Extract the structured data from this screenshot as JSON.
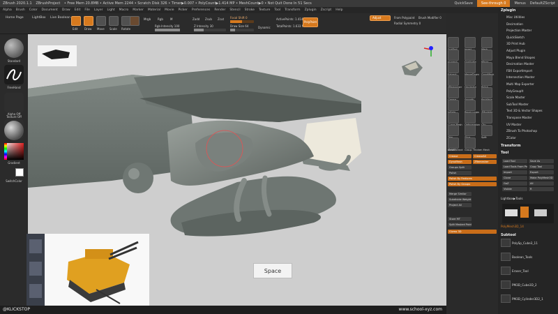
{
  "title_bar": {
    "app": "ZBrush 2020.1.1",
    "project": "ZBrushProject",
    "status": "• Free Mem 20.8MB • Active Mem 2244 • Scratch Disk 326 • Timer▶0.007 • PolyCount▶1.414 MP • MeshCount▶0 • Not Quit Done In 51 Secs",
    "quicksave": "QuickSave",
    "see_through": "See-through 0",
    "menus_label": "Menus",
    "script": "DefaultZScript"
  },
  "menu_bar": [
    "Alpha",
    "Brush",
    "Color",
    "Document",
    "Draw",
    "Edit",
    "File",
    "Layer",
    "Light",
    "Macro",
    "Marker",
    "Material",
    "Movie",
    "Picker",
    "Preferences",
    "Render",
    "Stencil",
    "Stroke",
    "Texture",
    "Tool",
    "Transform",
    "Zplugin",
    "Zscript",
    "Help"
  ],
  "right_menu": "Zplugin",
  "toolbar": {
    "home_page": "Home Page",
    "lightbox": "LightBox",
    "live_boolean": "Live Boolean",
    "edit": "Edit",
    "draw": "Draw",
    "move": "Move",
    "scale": "Scale",
    "rotate": "Rotate",
    "mrgb": "Mrgb",
    "rgb": "Rgb",
    "m": "M",
    "zadd": "Zadd",
    "zsub": "Zsub",
    "zcut": "Zcut",
    "focal_shift": "Focal Shift 0",
    "draw_size": "Draw Size 64",
    "dynamic": "Dynamic",
    "active_points": "ActivePoints: 1.414 Mil",
    "total_points": "TotalPoints: 1.633 Mil",
    "rgb_intensity": "Rgb Intensity 100",
    "z_intensity": "Z Intensity 30",
    "adjust": "Adjust",
    "polypaint": "PolyPaint",
    "from_polypaint": "From Polypaint",
    "radial_symmetry": "Radial Symmetry 0",
    "brush_modifier": "Brush Modifier 0"
  },
  "left_panel": {
    "standard": "Standard",
    "freehand": "FreeHand",
    "alpha_off": "Alpha Off",
    "texture_off": "Texture Off",
    "matcap": "MatCap Gray",
    "gradient": "Gradient",
    "switch_color": "SwitchColor",
    "alternate": "Alternate"
  },
  "viewport": {
    "space_key": "Space"
  },
  "bottom_bar": {
    "left": "@KLICKSTOP",
    "right": "www.school-xyz.com"
  },
  "shelf": {
    "labels": [
      "SubTool",
      "Insert",
      "Mesh",
      "Append",
      "Duplicate",
      "Mirror",
      "Extract",
      "MergeDown",
      "DynaMesh",
      "ZRemesher",
      "Decimate",
      "Polish",
      "Crease",
      "Smooth",
      "Backface",
      "Inflate",
      "Panel Loops",
      "ZModeler",
      "Curve Mesh",
      "Deformation",
      "Clip",
      "Trim",
      "Slice",
      "Split",
      "Delete",
      "Group"
    ],
    "mesh_label": "MeshExtract",
    "thicken": "Thicken Mesh"
  },
  "right_panel": {
    "zplugin_items": [
      "Misc Utilities",
      "Decimation",
      "Projection Master",
      "QuickSketch",
      "3D Print Hub",
      "Adjust Plugin",
      "Maya Blend Shapes",
      "Decimation Master",
      "FBX ExportImport",
      "Intersection Master",
      "Multi Map Exporter",
      "PolyGroupIt",
      "Scale Master",
      "SubTool Master",
      "Text 3D & Vector Shapes",
      "Transpose Master",
      "UV Master",
      "ZBrush To Photoshop",
      "ZColor"
    ],
    "transform": "Transform",
    "tool": "Tool",
    "tool_buttons": [
      "Load Tool",
      "Save As",
      "Load Tools From Project",
      "Copy Tool",
      "Import",
      "Export",
      "Clone",
      "Make PolyMesh3D",
      "GoZ",
      "All",
      "Visible",
      "R"
    ],
    "lightbox_tools": "Lightbox▶Tools",
    "polymesh_label": "PolyMesh3D_14",
    "subtool": "Subtool",
    "subtool_items": [
      "PolySp_Cube3_11",
      "Boolean_Tools",
      "Eraser_Tool",
      "PM3D_Cube3D_2",
      "PM3D_Cylinder3D2_1"
    ]
  },
  "mid_buttons": {
    "crease": "Crease",
    "creaseall": "CreaseAll",
    "uncrease": "Uncrease",
    "dynamesh": "DynaMesh",
    "zremesher": "ZRemesher",
    "groups_split": "Groups Split",
    "polish": "Polish",
    "polish_features": "Polish By Features",
    "polish_groups": "Polish By Groups",
    "merge": "Merge Similar",
    "sub": "Subdivide Weight",
    "project": "Project All",
    "store": "Store MT",
    "slice": "Split Masked Points",
    "gizmo": "Gizmo 3D"
  }
}
